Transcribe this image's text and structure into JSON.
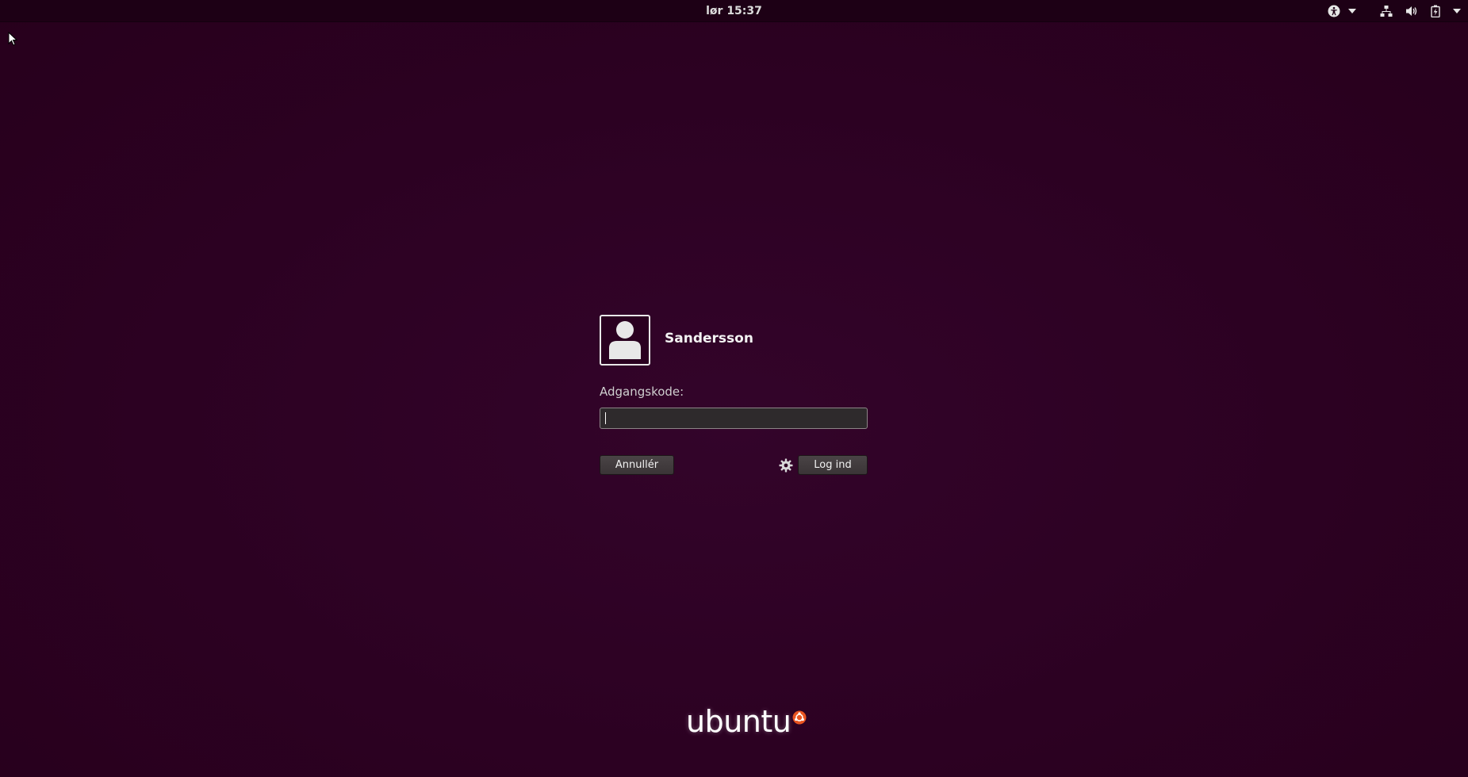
{
  "topbar": {
    "clock": "lør 15:37",
    "icons": [
      "accessibility-icon",
      "chevron-down-icon",
      "network-icon",
      "volume-icon",
      "battery-icon",
      "chevron-down-icon"
    ]
  },
  "login": {
    "username": "Sandersson",
    "password_label": "Adgangskode:",
    "password_value": "",
    "password_placeholder": "",
    "cancel_label": "Annullér",
    "login_label": "Log ind",
    "session_icon": "gear-icon"
  },
  "branding": {
    "logo_text": "ubuntu"
  },
  "colors": {
    "background": "#2c001e",
    "topbar": "#1d0015",
    "text": "#f2f2f2",
    "button": "#3f393b"
  }
}
